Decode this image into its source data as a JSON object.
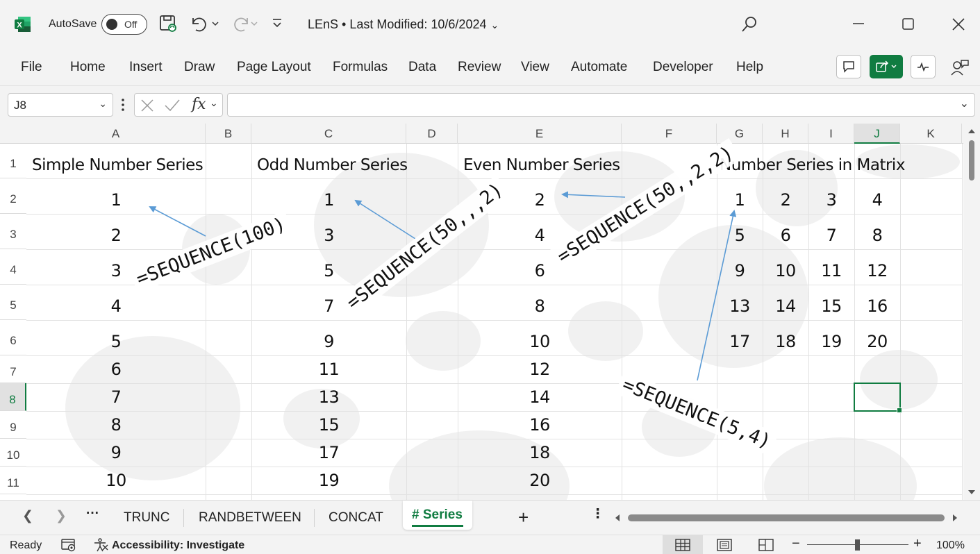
{
  "titlebar": {
    "autosave_label": "AutoSave",
    "autosave_state": "Off",
    "doc_title": "LEnS • Last Modified: 10/6/2024"
  },
  "ribbon": {
    "tabs": [
      "File",
      "Home",
      "Insert",
      "Draw",
      "Page Layout",
      "Formulas",
      "Data",
      "Review",
      "View",
      "Automate",
      "Developer",
      "Help"
    ]
  },
  "formula_bar": {
    "name_box": "J8",
    "fx_label": "fx",
    "formula": ""
  },
  "grid": {
    "columns": [
      "A",
      "B",
      "C",
      "D",
      "E",
      "F",
      "G",
      "H",
      "I",
      "J",
      "K"
    ],
    "rows": [
      "1",
      "2",
      "3",
      "4",
      "5",
      "6",
      "7",
      "8",
      "9",
      "10",
      "11"
    ],
    "active_column": "J",
    "active_row": "8",
    "headers": {
      "A1": "Simple Number Series",
      "C1": "Odd Number Series",
      "E1": "Even Number Series",
      "G1": "Number Series in Matrix"
    },
    "col_A": [
      "1",
      "2",
      "3",
      "4",
      "5",
      "6",
      "7",
      "8",
      "9",
      "10"
    ],
    "col_C": [
      "1",
      "3",
      "5",
      "7",
      "9",
      "11",
      "13",
      "15",
      "17",
      "19"
    ],
    "col_E": [
      "2",
      "4",
      "6",
      "8",
      "10",
      "12",
      "14",
      "16",
      "18",
      "20"
    ],
    "matrix": [
      [
        "1",
        "2",
        "3",
        "4"
      ],
      [
        "5",
        "6",
        "7",
        "8"
      ],
      [
        "9",
        "10",
        "11",
        "12"
      ],
      [
        "13",
        "14",
        "15",
        "16"
      ],
      [
        "17",
        "18",
        "19",
        "20"
      ]
    ]
  },
  "annotations": {
    "seq_simple": "=SEQUENCE(100)",
    "seq_odd": "=SEQUENCE(50,,,2)",
    "seq_even": "=SEQUENCE(50,,2,2)",
    "seq_matrix": "=SEQUENCE(5,4)"
  },
  "sheets": {
    "tabs": [
      "TRUNC",
      "RANDBETWEEN",
      "CONCAT"
    ],
    "active": "# Series",
    "add_label": "+"
  },
  "status": {
    "ready": "Ready",
    "accessibility": "Accessibility: Investigate",
    "zoom": "100%"
  },
  "colors": {
    "accent": "#107c41",
    "arrow": "#5b9bd5"
  }
}
